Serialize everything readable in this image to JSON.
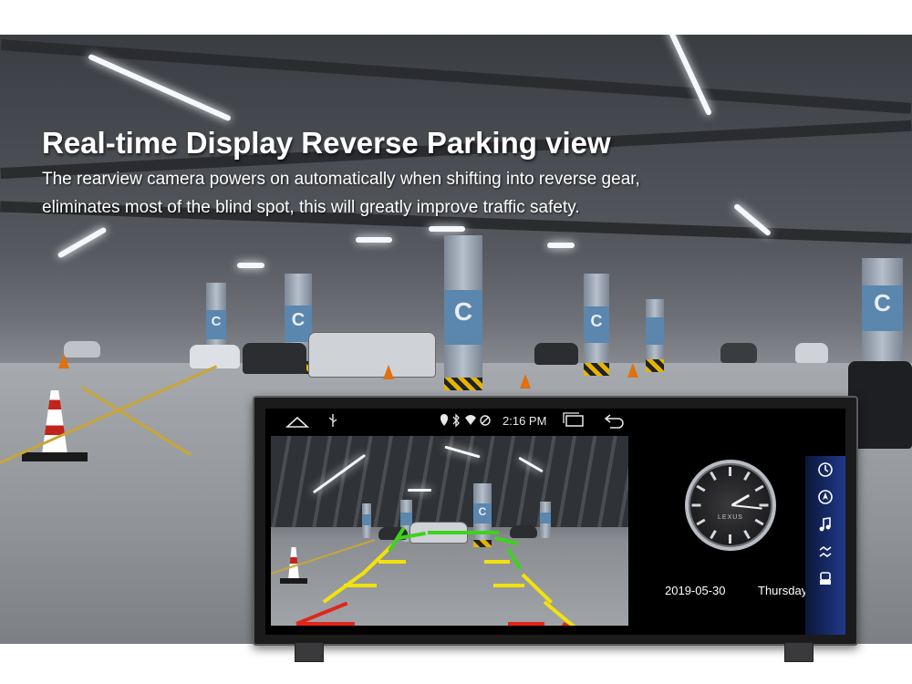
{
  "headline": {
    "title": "Real-time Display Reverse Parking view",
    "line1": "The rearview camera powers on automatically when shifting into reverse gear,",
    "line2": "eliminates most of the blind spot, this will greatly improve traffic safety."
  },
  "scene": {
    "pillar_letter": "C"
  },
  "device": {
    "statusbar": {
      "home_icon": "home-icon",
      "usb_icon": "usb-icon",
      "status_icons": "location-icon bluetooth-icon wifi-icon",
      "time": "2:16 PM",
      "recent_apps_icon": "recent-apps-icon",
      "back_icon": "back-icon"
    },
    "clock": {
      "brand": "LEXUS",
      "date": "2019-05-30",
      "day": "Thursday"
    },
    "sidebar": {
      "items": [
        "clock-icon",
        "navigation-icon",
        "music-icon",
        "connect-icon",
        "car-settings-icon"
      ]
    }
  },
  "colors": {
    "guide_red": "#e2261c",
    "guide_yellow": "#f2e20a",
    "guide_green": "#3fd21c",
    "sidebar_blue": "#203a8c"
  }
}
